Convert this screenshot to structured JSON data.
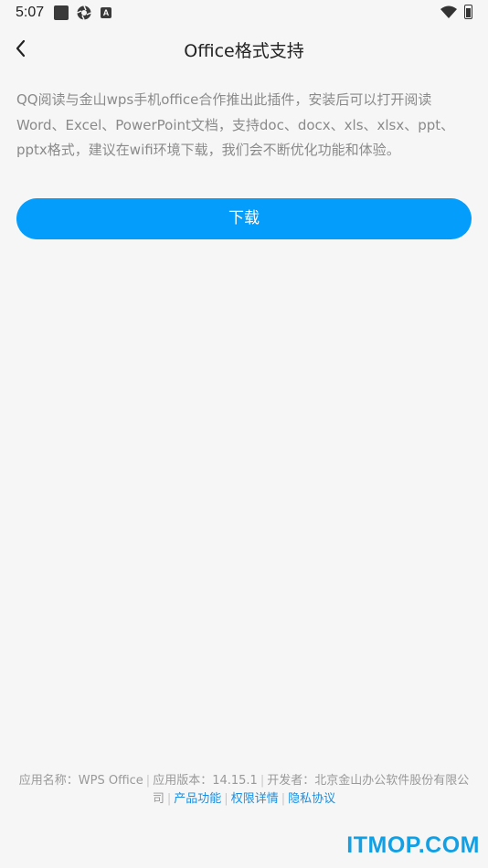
{
  "status_bar": {
    "time": "5:07",
    "a_icon_letter": "A"
  },
  "header": {
    "title": "Office格式支持"
  },
  "content": {
    "description": "QQ阅读与金山wps手机office合作推出此插件，安装后可以打开阅读Word、Excel、PowerPoint文档，支持doc、docx、xls、xlsx、ppt、pptx格式，建议在wifi环境下载，我们会不断优化功能和体验。",
    "download_label": "下载"
  },
  "footer": {
    "app_name": "应用名称：WPS Office",
    "app_version": "应用版本：14.15.1",
    "developer": "开发者：北京金山办公软件股份有限公司",
    "links": {
      "features": "产品功能",
      "permissions": "权限详情",
      "privacy": "隐私协议"
    }
  },
  "watermark": "ITMOP.COM",
  "colors": {
    "accent": "#049dfc",
    "link": "#1c8fe0",
    "background": "#f6f6f6"
  }
}
